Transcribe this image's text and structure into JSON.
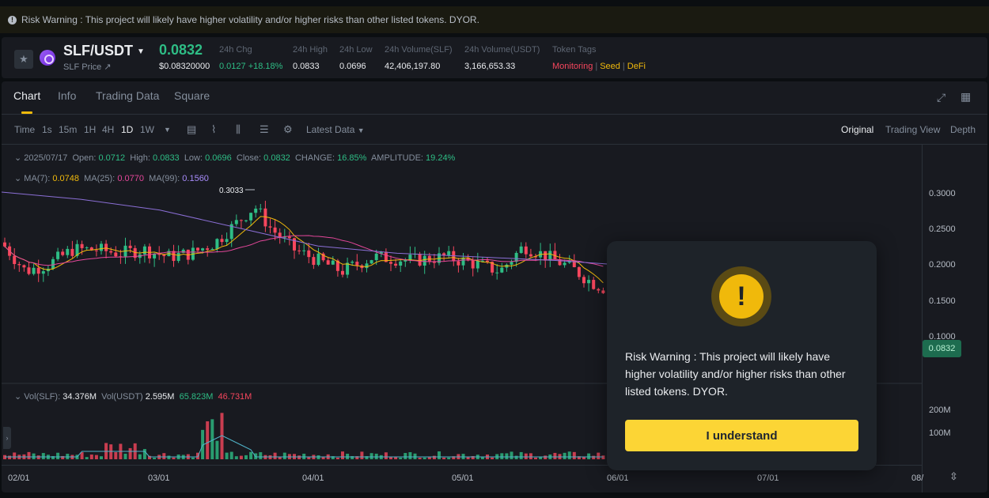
{
  "banner": {
    "text": "Risk Warning : This project will likely have higher volatility and/or higher risks than other listed tokens. DYOR.",
    "icon": "warning-circle-icon"
  },
  "ticker": {
    "pair": "SLF/USDT",
    "price_link": "SLF Price ↗",
    "last_price": "0.0832",
    "last_price_usd": "$0.08320000",
    "stats": [
      {
        "label": "24h Chg",
        "value": "0.0127 +18.18%"
      },
      {
        "label": "24h High",
        "value": "0.0833"
      },
      {
        "label": "24h Low",
        "value": "0.0696"
      },
      {
        "label": "24h Volume(SLF)",
        "value": "42,406,197.80"
      },
      {
        "label": "24h Volume(USDT)",
        "value": "3,166,653.33"
      }
    ],
    "tags_label": "Token Tags",
    "tags": [
      "Monitoring",
      "Seed",
      "DeFi"
    ],
    "colors": {
      "up": "#2ebd85",
      "down": "#f6465d",
      "accent": "#f0b90b"
    }
  },
  "tabs": [
    "Chart",
    "Info",
    "Trading Data",
    "Square"
  ],
  "toolbar": {
    "intervals": [
      "Time",
      "1s",
      "15m",
      "1H",
      "4H",
      "1D",
      "1W"
    ],
    "active_interval": "1D",
    "latest_data": "Latest Data",
    "views": [
      "Original",
      "Trading View",
      "Depth"
    ]
  },
  "ohlc": {
    "date": "2025/07/17",
    "open_label": "Open:",
    "open": "0.0712",
    "high_label": "High:",
    "high": "0.0833",
    "low_label": "Low:",
    "low": "0.0696",
    "close_label": "Close:",
    "close": "0.0832",
    "change_label": "CHANGE:",
    "change": "16.85%",
    "amp_label": "AMPLITUDE:",
    "amp": "19.24%"
  },
  "ma": {
    "ma7_label": "MA(7):",
    "ma7": "0.0748",
    "ma25_label": "MA(25):",
    "ma25": "0.0770",
    "ma99_label": "MA(99):",
    "ma99": "0.1560"
  },
  "vol": {
    "slf_label": "Vol(SLF):",
    "slf": "34.376M",
    "usdt_label": "Vol(USDT)",
    "usdt": "2.595M",
    "v1": "65.823M",
    "v2": "46.731M"
  },
  "price_axis": [
    "0.3000",
    "0.2500",
    "0.2000",
    "0.1500",
    "0.1000"
  ],
  "volume_axis": [
    "200M",
    "100M"
  ],
  "last_price_tag": "0.0832",
  "peak_label": "0.3033",
  "date_axis": [
    "02/01",
    "03/01",
    "04/01",
    "05/01",
    "06/01",
    "07/01",
    "08/"
  ],
  "modal": {
    "text": "Risk Warning : This project will likely have higher volatility and/or higher risks than other listed tokens. DYOR.",
    "button": "I understand",
    "icon": "exclamation-icon"
  }
}
